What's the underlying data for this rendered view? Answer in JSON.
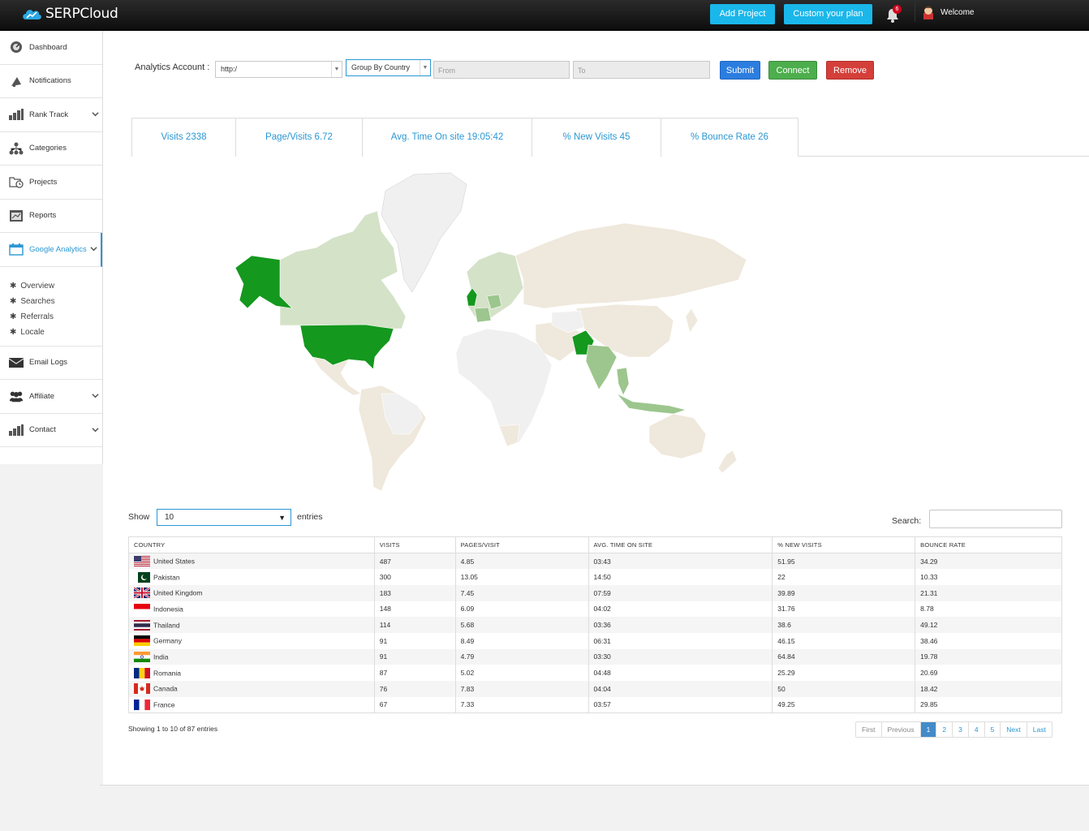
{
  "header": {
    "brand": "SERPCloud",
    "add_project": "Add Project",
    "custom_plan": "Custom your plan",
    "notification_count": "6",
    "welcome": "Welcome"
  },
  "sidebar": {
    "items": [
      {
        "label": "Dashboard",
        "icon": "dashboard-icon"
      },
      {
        "label": "Notifications",
        "icon": "megaphone-icon"
      },
      {
        "label": "Rank Track",
        "icon": "bar-chart-icon"
      },
      {
        "label": "Categories",
        "icon": "sitemap-icon"
      },
      {
        "label": "Projects",
        "icon": "folder-clock-icon"
      },
      {
        "label": "Reports",
        "icon": "report-icon"
      },
      {
        "label": "Google Analytics",
        "icon": "calendar-icon"
      },
      {
        "label": "Email Logs",
        "icon": "envelope-icon"
      },
      {
        "label": "Affiliate",
        "icon": "users-icon"
      },
      {
        "label": "Contact",
        "icon": "bar-chart-icon"
      }
    ],
    "sub_items": [
      "Overview",
      "Searches",
      "Referrals",
      "Locale"
    ]
  },
  "filters": {
    "account_label": "Analytics Account :",
    "account_value": "http:/",
    "group_by": "Group By Country",
    "from_placeholder": "From",
    "to_placeholder": "To",
    "submit": "Submit",
    "connect": "Connect",
    "remove": "Remove"
  },
  "stats": {
    "visits": "Visits 2338",
    "page_visits": "Page/Visits  6.72",
    "avg_time": "Avg. Time On site  19:05:42",
    "new_visits": "% New Visits  45",
    "bounce": "% Bounce Rate  26"
  },
  "table_controls": {
    "show": "Show",
    "entries_value": "10",
    "entries": "entries",
    "search": "Search:"
  },
  "table": {
    "headers": [
      "COUNTRY",
      "VISITS",
      "PAGES/VISIT",
      "AVG. TIME ON SITE",
      "% NEW VISITS",
      "BOUNCE RATE"
    ],
    "rows": [
      {
        "country": "United States",
        "flag": "us",
        "visits": "487",
        "pages": "4.85",
        "time": "03:43",
        "new": "51.95",
        "bounce": "34.29"
      },
      {
        "country": "Pakistan",
        "flag": "pk",
        "visits": "300",
        "pages": "13.05",
        "time": "14:50",
        "new": "22",
        "bounce": "10.33"
      },
      {
        "country": "United Kingdom",
        "flag": "gb",
        "visits": "183",
        "pages": "7.45",
        "time": "07:59",
        "new": "39.89",
        "bounce": "21.31"
      },
      {
        "country": "Indonesia",
        "flag": "id",
        "visits": "148",
        "pages": "6.09",
        "time": "04:02",
        "new": "31.76",
        "bounce": "8.78"
      },
      {
        "country": "Thailand",
        "flag": "th",
        "visits": "114",
        "pages": "5.68",
        "time": "03:36",
        "new": "38.6",
        "bounce": "49.12"
      },
      {
        "country": "Germany",
        "flag": "de",
        "visits": "91",
        "pages": "8.49",
        "time": "06:31",
        "new": "46.15",
        "bounce": "38.46"
      },
      {
        "country": "India",
        "flag": "in",
        "visits": "91",
        "pages": "4.79",
        "time": "03:30",
        "new": "64.84",
        "bounce": "19.78"
      },
      {
        "country": "Romania",
        "flag": "ro",
        "visits": "87",
        "pages": "5.02",
        "time": "04:48",
        "new": "25.29",
        "bounce": "20.69"
      },
      {
        "country": "Canada",
        "flag": "ca",
        "visits": "76",
        "pages": "7.83",
        "time": "04:04",
        "new": "50",
        "bounce": "18.42"
      },
      {
        "country": "France",
        "flag": "fr",
        "visits": "67",
        "pages": "7.33",
        "time": "03:57",
        "new": "49.25",
        "bounce": "29.85"
      }
    ]
  },
  "pagination": {
    "info": "Showing 1 to 10 of 87 entries",
    "first": "First",
    "previous": "Previous",
    "pages": [
      "1",
      "2",
      "3",
      "4",
      "5"
    ],
    "next": "Next",
    "last": "Last"
  },
  "colors": {
    "accent": "#2b97d3",
    "top_button": "#1ab7ea",
    "submit": "#2b7de0",
    "connect": "#4cae4c",
    "remove": "#d43f3a",
    "map_high": "#14981e",
    "map_mid": "#9cc68d",
    "map_low": "#d4e2c8",
    "map_none": "#efe8dc",
    "map_empty": "#f0f0f0"
  }
}
